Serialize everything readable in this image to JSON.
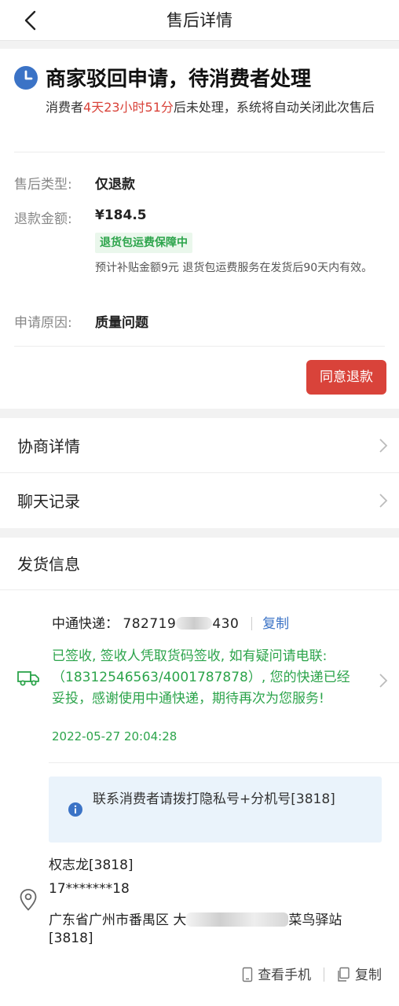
{
  "nav": {
    "title": "售后详情"
  },
  "status": {
    "title": "商家驳回申请，待消费者处理",
    "desc_prefix": "消费者",
    "countdown": "4天23小时51分",
    "desc_suffix": "后未处理，系统将自动关闭此次售后"
  },
  "details": {
    "type_label": "售后类型:",
    "type_value": "仅退款",
    "amount_label": "退款金额:",
    "amount_value": "¥184.5",
    "tag": "退货包运费保障中",
    "note": "预计补贴金额9元 退货包运费服务在发货后90天内有效。",
    "reason_label": "申请原因:",
    "reason_value": "质量问题"
  },
  "actions": {
    "agree_label": "同意退款"
  },
  "links": [
    {
      "label": "协商详情"
    },
    {
      "label": "聊天记录"
    }
  ],
  "shipping": {
    "title": "发货信息",
    "carrier_label": "中通快递：",
    "tracking_start": "782719",
    "tracking_end": "430",
    "copy_label": "复制",
    "tracking_text": "已签收, 签收人凭取货码签收, 如有疑问请电联:（18312546563/4001787878）, 您的快递已经妥投，感谢使用中通快递，期待再次为您服务!",
    "tracking_time": "2022-05-27 20:04:28",
    "info": "联系消费者请拨打隐私号+分机号[3818]",
    "receiver_name": "权志龙[3818]",
    "receiver_phone": "17*******18",
    "address_start": "广东省广州市番禺区 大",
    "address_end": "菜鸟驿站",
    "address_ext": "[3818]",
    "view_phone_label": "查看手机",
    "copy_addr_label": "复制"
  }
}
